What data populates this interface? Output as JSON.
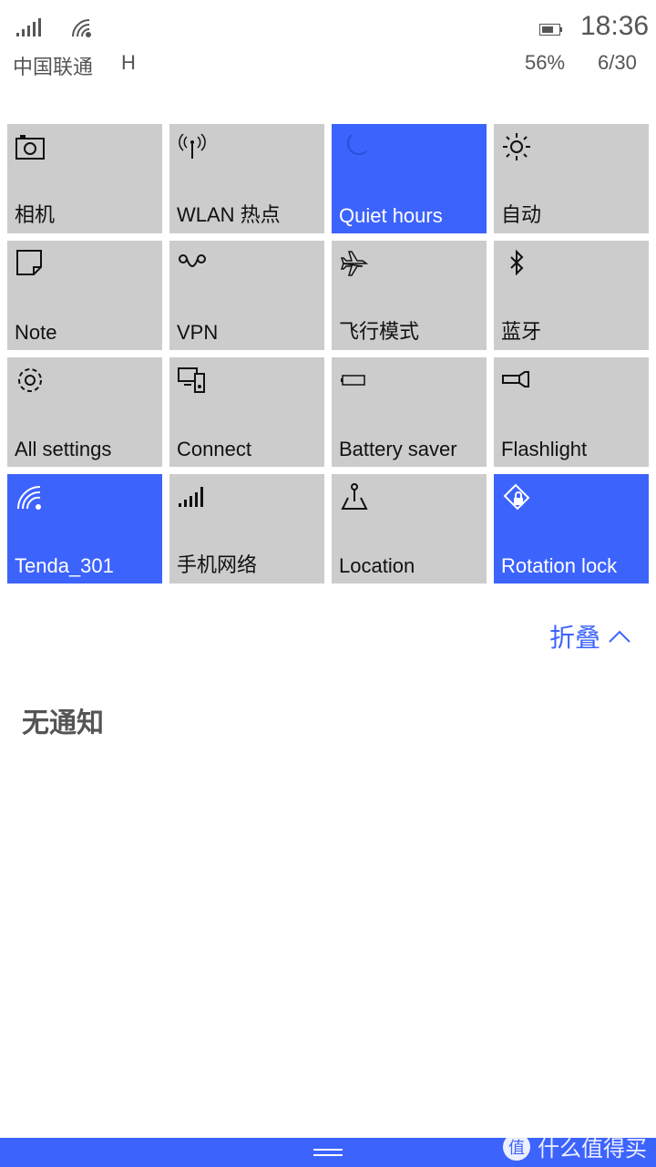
{
  "status": {
    "time": "18:36",
    "carrier": "中国联通",
    "network_type": "H",
    "battery": "56%",
    "date": "6/30",
    "icons": [
      "signal-icon",
      "wifi-icon",
      "battery-icon"
    ]
  },
  "tiles": [
    {
      "label": "相机",
      "icon": "camera-icon",
      "active": false
    },
    {
      "label": "WLAN 热点",
      "icon": "hotspot-icon",
      "active": false
    },
    {
      "label": "Quiet hours",
      "icon": "moon-icon",
      "active": true
    },
    {
      "label": "自动",
      "icon": "brightness-icon",
      "active": false
    },
    {
      "label": "Note",
      "icon": "note-icon",
      "active": false
    },
    {
      "label": "VPN",
      "icon": "vpn-icon",
      "active": false
    },
    {
      "label": "飞行模式",
      "icon": "airplane-icon",
      "active": false
    },
    {
      "label": "蓝牙",
      "icon": "bluetooth-icon",
      "active": false
    },
    {
      "label": "All settings",
      "icon": "gear-icon",
      "active": false
    },
    {
      "label": "Connect",
      "icon": "connect-icon",
      "active": false
    },
    {
      "label": "Battery saver",
      "icon": "battery-saver-icon",
      "active": false
    },
    {
      "label": "Flashlight",
      "icon": "flashlight-icon",
      "active": false
    },
    {
      "label": "Tenda_301",
      "icon": "wifi-icon",
      "active": true
    },
    {
      "label": "手机网络",
      "icon": "cellular-icon",
      "active": false
    },
    {
      "label": "Location",
      "icon": "location-icon",
      "active": false
    },
    {
      "label": "Rotation lock",
      "icon": "rotation-lock-icon",
      "active": true
    }
  ],
  "collapse_label": "折叠",
  "no_notifications": "无通知",
  "watermark": "什么值得买",
  "colors": {
    "accent": "#3d63fd",
    "tile": "#cccccc"
  }
}
